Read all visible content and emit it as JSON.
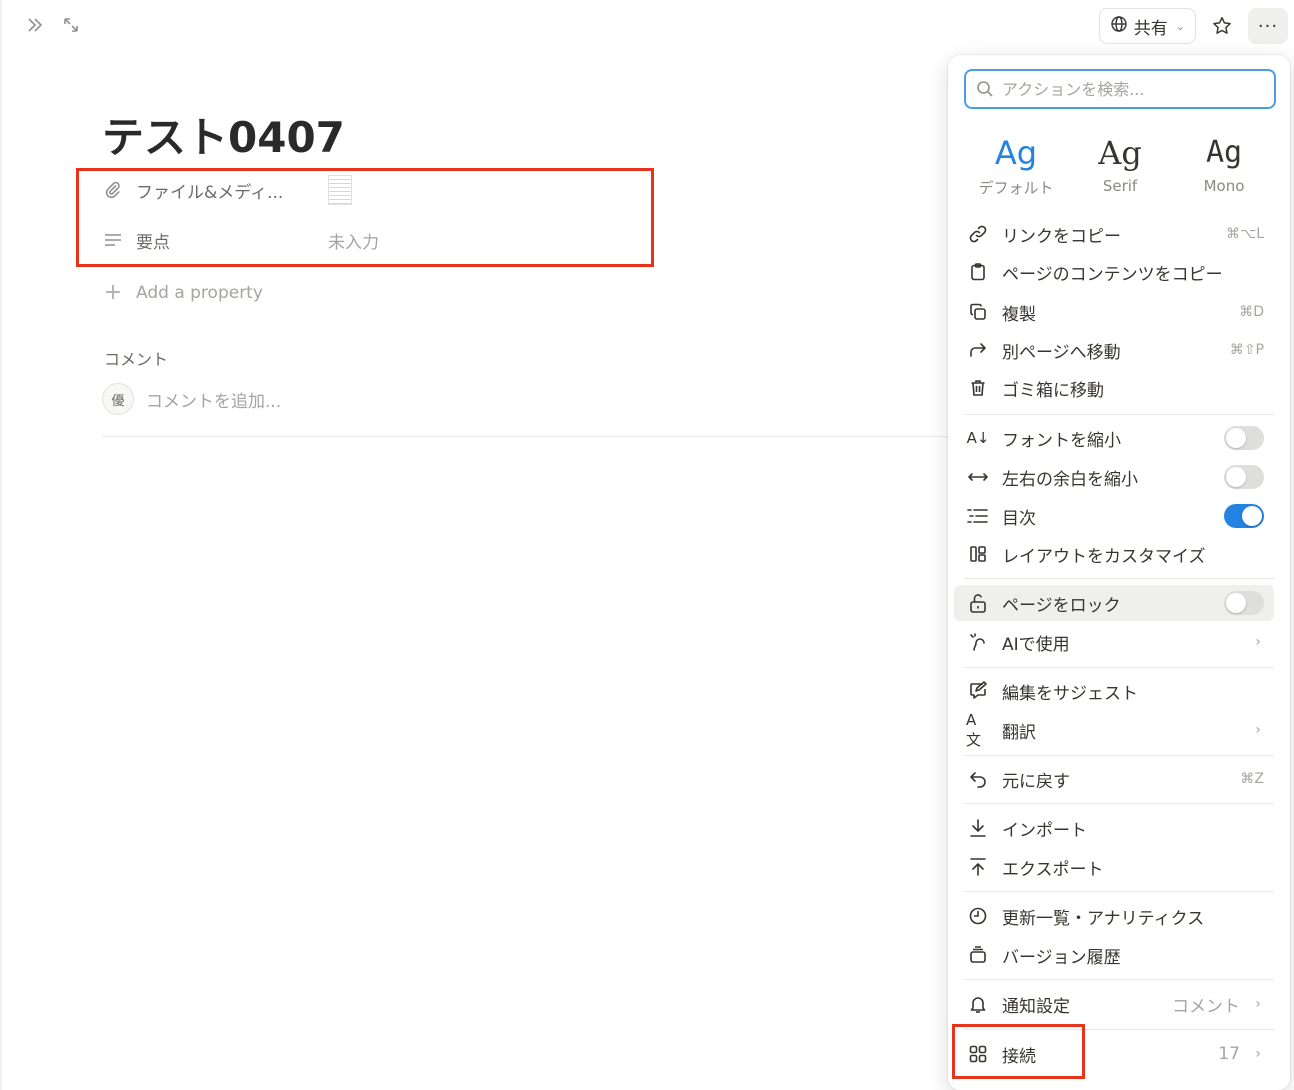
{
  "topbar": {
    "sidebar_toggle_icon": "double-chevron-right-icon",
    "expand_icon": "expand-arrows-icon",
    "share_label": "共有",
    "star_icon": "star-icon",
    "more_label": "···"
  },
  "page": {
    "title": "テスト0407",
    "properties": [
      {
        "icon": "paperclip-icon",
        "name": "ファイル&メディ...",
        "value": ""
      },
      {
        "icon": "text-lines-icon",
        "name": "要点",
        "value": "未入力"
      }
    ],
    "add_property": "Add a property",
    "comments": {
      "heading": "コメント",
      "avatar_text": "優",
      "placeholder": "コメントを追加..."
    }
  },
  "menu": {
    "search_placeholder": "アクションを検索...",
    "fonts": [
      {
        "sample": "Ag",
        "label": "デフォルト"
      },
      {
        "sample": "Ag",
        "label": "Serif"
      },
      {
        "sample": "Ag",
        "label": "Mono"
      }
    ],
    "items": [
      {
        "label": "リンクをコピー",
        "shortcut": "⌘⌥L"
      },
      {
        "label": "ページのコンテンツをコピー",
        "shortcut": ""
      },
      {
        "label": "複製",
        "shortcut": "⌘D"
      },
      {
        "label": "別ページへ移動",
        "shortcut": "⌘⇧P"
      },
      {
        "label": "ゴミ箱に移動",
        "shortcut": ""
      },
      {
        "label": "フォントを縮小",
        "toggle": false
      },
      {
        "label": "左右の余白を縮小",
        "toggle": false
      },
      {
        "label": "目次",
        "toggle": true
      },
      {
        "label": "レイアウトをカスタマイズ"
      },
      {
        "label": "ページをロック",
        "toggle": false
      },
      {
        "label": "AIで使用"
      },
      {
        "label": "編集をサジェスト"
      },
      {
        "label": "翻訳"
      },
      {
        "label": "元に戻す",
        "shortcut": "⌘Z"
      },
      {
        "label": "インポート"
      },
      {
        "label": "エクスポート"
      },
      {
        "label": "更新一覧・アナリティクス"
      },
      {
        "label": "バージョン履歴"
      },
      {
        "label": "通知設定",
        "value": "コメント"
      },
      {
        "label": "接続",
        "value": "17"
      }
    ]
  },
  "colors": {
    "accent": "#2383e2",
    "highlight_box": "#e8341c"
  }
}
